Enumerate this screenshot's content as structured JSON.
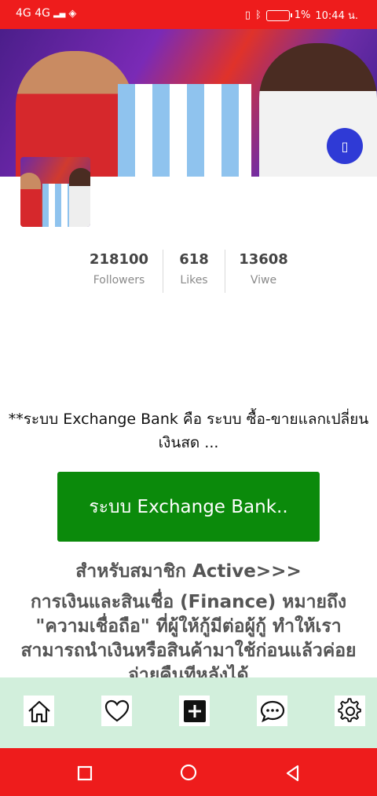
{
  "status_bar": {
    "network": "4G 4G",
    "battery": "1%",
    "time": "10:44 น."
  },
  "profile": {
    "stats": [
      {
        "value": "218100",
        "label": "Followers"
      },
      {
        "value": "618",
        "label": "Likes"
      },
      {
        "value": "13608",
        "label": "Viwe"
      }
    ]
  },
  "content": {
    "description_line1": "**ระบบ Exchange Bank คือ ระบบ ซื้อ-ขายแลกเปลี่ยน",
    "description_line2": "เงินสด ...",
    "button_label": "ระบบ Exchange Bank..",
    "member_heading": "สำหรับสมาชิก Active>>>",
    "finance_line1": "การเงินและสินเชื่อ (Finance) หมายถึง",
    "finance_line2": "\"ความเชื่อถือ\" ที่ผู้ให้กู้มีต่อผู้กู้ ทำให้เรา",
    "finance_line3": "สามารถนำเงินหรือสินค้ามาใช้ก่อนแล้วค่อย",
    "finance_line4": "จ่ายคืนทีหลังได้"
  },
  "icons": {
    "cover_action": "unknown-glyph-icon",
    "nav": [
      "home-icon",
      "heart-icon",
      "add-icon",
      "chat-icon",
      "settings-icon"
    ],
    "system": [
      "recents-icon",
      "home-circle-icon",
      "back-icon"
    ]
  },
  "colors": {
    "status_bar": "#ee1c1c",
    "button": "#0b8a0b",
    "bottom_nav": "#d2efdc",
    "fab": "#2f3ad6"
  }
}
